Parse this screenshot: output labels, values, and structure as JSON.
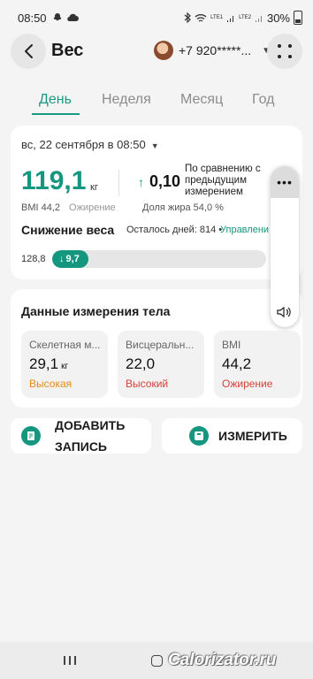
{
  "status_bar": {
    "time": "08:50",
    "net1": "LTE1",
    "net2": "LTE2",
    "battery": "30%"
  },
  "header": {
    "title": "Вес",
    "phone": "+7 920*****...",
    "back_icon": "arrow-left",
    "menu_icon": "four-dots"
  },
  "tabs": [
    {
      "label": "День",
      "active": true
    },
    {
      "label": "Неделя",
      "active": false
    },
    {
      "label": "Месяц",
      "active": false
    },
    {
      "label": "Год",
      "active": false
    }
  ],
  "summary": {
    "date": "вс, 22 сентября в 08:50",
    "weight": "119,1",
    "weight_unit": "кг",
    "change": "0,10",
    "change_text": "По сравнению с предыдущим измерением",
    "bmi": "BMI 44,2",
    "bmi_status": "Ожирение",
    "fat": "Доля жира 54,0 %",
    "loss_title": "Снижение веса",
    "days_left": "Осталось дней: 814 •",
    "manage": "Управлени",
    "start_weight": "128,8",
    "progress_value": "9,7",
    "progress_fraction": 0.17
  },
  "body": {
    "title": "Данные измерения тела",
    "tiles": [
      {
        "label": "Скелетная м...",
        "value": "29,1",
        "unit": "кг",
        "status": "Высокая",
        "status_color": "#e58a1a"
      },
      {
        "label": "Висцеральн...",
        "value": "22,0",
        "unit": "",
        "status": "Высокий",
        "status_color": "#d6403a"
      },
      {
        "label": "BMI",
        "value": "44,2",
        "unit": "",
        "status": "Ожирение",
        "status_color": "#d6403a"
      }
    ]
  },
  "actions": {
    "add_label_1": "ДОБАВИТЬ",
    "add_label_2": "ЗАПИСЬ",
    "measure_label": "ИЗМЕРИТЬ"
  },
  "float_panel": {
    "menu_glyph": "•••"
  },
  "watermark": "Calorizator.ru",
  "colors": {
    "accent": "#15967f",
    "background": "#f4f4f4"
  }
}
